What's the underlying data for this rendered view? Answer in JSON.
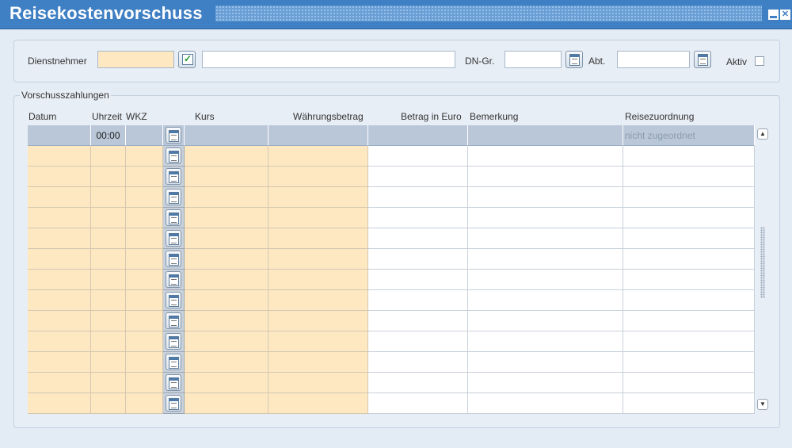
{
  "window": {
    "title": "Reisekostenvorschuss"
  },
  "header": {
    "dienstnehmer_label": "Dienstnehmer",
    "dienstnehmer_id_value": "",
    "dienstnehmer_name_value": "",
    "dngr_label": "DN-Gr.",
    "dngr_value": "",
    "abt_label": "Abt.",
    "abt_value": "",
    "aktiv_label": "Aktiv",
    "aktiv_checked": false
  },
  "grid": {
    "legend": "Vorschusszahlungen",
    "columns": [
      "Datum",
      "Uhrzeit",
      "WKZ",
      "Kurs",
      "Währungsbetrag",
      "Betrag in Euro",
      "Bemerkung",
      "Reisezuordnung"
    ],
    "first_row": {
      "uhrzeit": "00:00",
      "reisezuordnung": "nicht zugeordnet"
    },
    "row_count": 14
  },
  "icons": {
    "title_min": "minimize-icon",
    "title_close": "close-icon",
    "lookup": "checklist-icon",
    "list": "list-icon"
  }
}
